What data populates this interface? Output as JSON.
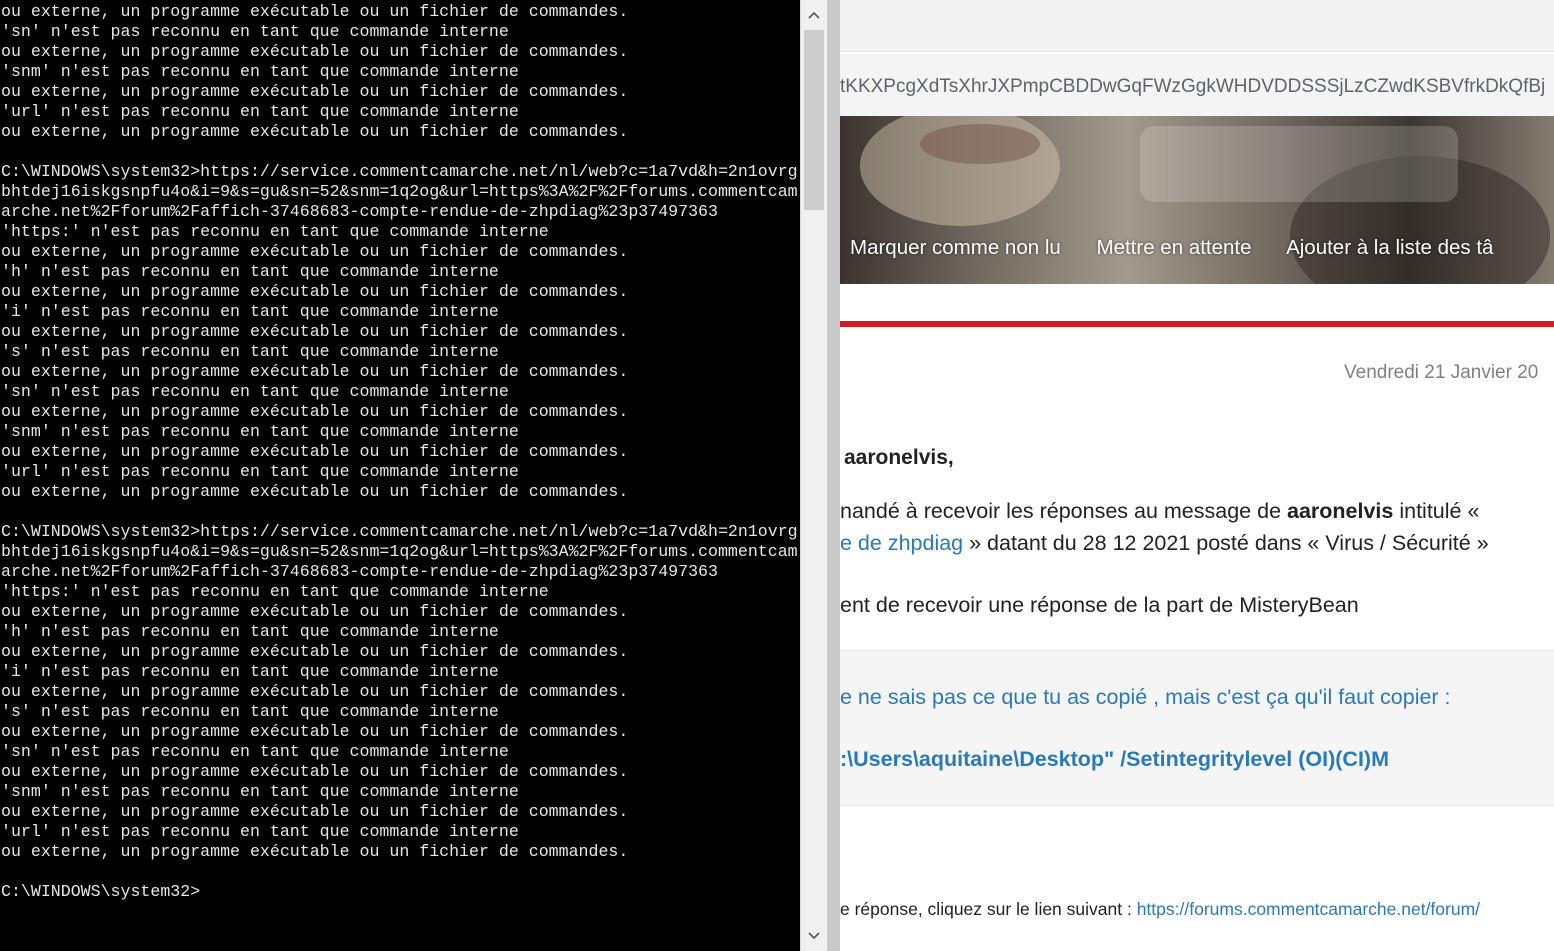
{
  "console": {
    "lines": [
      "ou externe, un programme exécutable ou un fichier de commandes.",
      "'sn' n'est pas reconnu en tant que commande interne",
      "ou externe, un programme exécutable ou un fichier de commandes.",
      "'snm' n'est pas reconnu en tant que commande interne",
      "ou externe, un programme exécutable ou un fichier de commandes.",
      "'url' n'est pas reconnu en tant que commande interne",
      "ou externe, un programme exécutable ou un fichier de commandes.",
      "",
      "C:\\WINDOWS\\system32>https://service.commentcamarche.net/nl/web?c=1a7vd&h=2n1ovrg",
      "bhtdej16iskgsnpfu4o&i=9&s=gu&sn=52&snm=1q2og&url=https%3A%2F%2Fforums.commentcam",
      "arche.net%2Fforum%2Faffich-37468683-compte-rendue-de-zhpdiag%23p37497363",
      "'https:' n'est pas reconnu en tant que commande interne",
      "ou externe, un programme exécutable ou un fichier de commandes.",
      "'h' n'est pas reconnu en tant que commande interne",
      "ou externe, un programme exécutable ou un fichier de commandes.",
      "'i' n'est pas reconnu en tant que commande interne",
      "ou externe, un programme exécutable ou un fichier de commandes.",
      "'s' n'est pas reconnu en tant que commande interne",
      "ou externe, un programme exécutable ou un fichier de commandes.",
      "'sn' n'est pas reconnu en tant que commande interne",
      "ou externe, un programme exécutable ou un fichier de commandes.",
      "'snm' n'est pas reconnu en tant que commande interne",
      "ou externe, un programme exécutable ou un fichier de commandes.",
      "'url' n'est pas reconnu en tant que commande interne",
      "ou externe, un programme exécutable ou un fichier de commandes.",
      "",
      "C:\\WINDOWS\\system32>https://service.commentcamarche.net/nl/web?c=1a7vd&h=2n1ovrg",
      "bhtdej16iskgsnpfu4o&i=9&s=gu&sn=52&snm=1q2og&url=https%3A%2F%2Fforums.commentcam",
      "arche.net%2Fforum%2Faffich-37468683-compte-rendue-de-zhpdiag%23p37497363",
      "'https:' n'est pas reconnu en tant que commande interne",
      "ou externe, un programme exécutable ou un fichier de commandes.",
      "'h' n'est pas reconnu en tant que commande interne",
      "ou externe, un programme exécutable ou un fichier de commandes.",
      "'i' n'est pas reconnu en tant que commande interne",
      "ou externe, un programme exécutable ou un fichier de commandes.",
      "'s' n'est pas reconnu en tant que commande interne",
      "ou externe, un programme exécutable ou un fichier de commandes.",
      "'sn' n'est pas reconnu en tant que commande interne",
      "ou externe, un programme exécutable ou un fichier de commandes.",
      "'snm' n'est pas reconnu en tant que commande interne",
      "ou externe, un programme exécutable ou un fichier de commandes.",
      "'url' n'est pas reconnu en tant que commande interne",
      "ou externe, un programme exécutable ou un fichier de commandes.",
      "",
      "C:\\WINDOWS\\system32>"
    ],
    "scroll_up_icon": "chevron-up-icon",
    "scroll_down_icon": "chevron-down-icon"
  },
  "browser": {
    "url_fragment": "tKKXPcgXdTsXhrJXPmpCBDDwGqFWzGgkWHDVDDSSSjLzCZwdKSBVfrkDkQfBj",
    "filter_icon": "tune-sliders-icon",
    "banner_menu": [
      "Marquer comme non lu",
      "Mettre en attente",
      "Ajouter à la liste des tâ"
    ],
    "colors": {
      "accent_red": "#d21b25",
      "link_blue": "#2a7ab9"
    }
  },
  "mail": {
    "date": "Vendredi 21 Janvier 20",
    "greeting": "aaronelvis,",
    "line1_prefix": "nandé à recevoir les réponses au message de ",
    "line1_author": "aaronelvis",
    "line1_suffix": " intitulé «",
    "line2_link": "e de zhpdiag",
    "line2_rest": " » datant du 28 12 2021 posté dans « Virus / Sécurité »",
    "line3": "ent de recevoir une réponse de la part de MisteryBean",
    "quote_line1": "e ne sais pas ce que tu as copié , mais c'est ça qu'il faut copier :",
    "quote_line2": ":\\Users\\aquitaine\\Desktop\" /Setintegritylevel (OI)(CI)M",
    "footer_text": "e réponse, cliquez sur le lien suivant : ",
    "footer_link": "https://forums.commentcamarche.net/forum/"
  }
}
